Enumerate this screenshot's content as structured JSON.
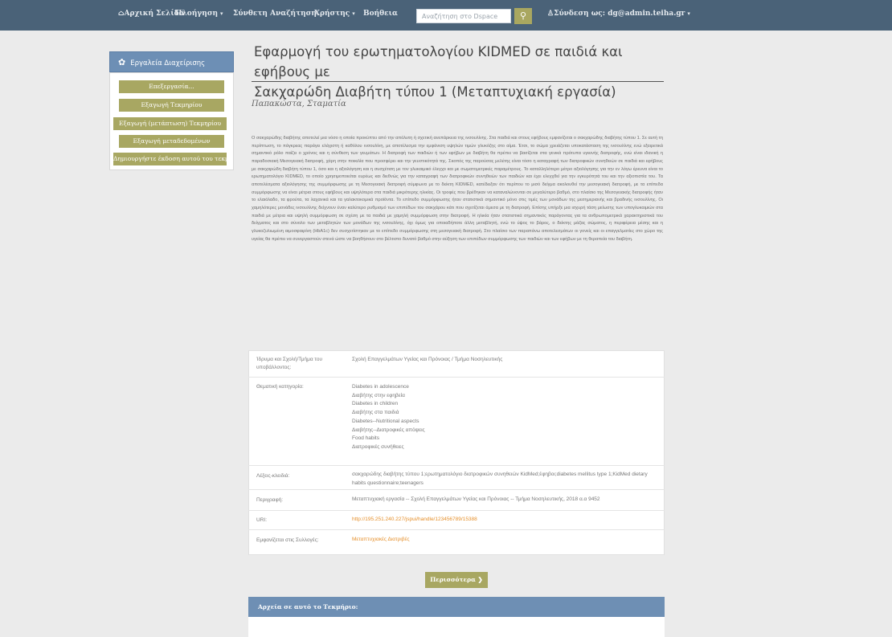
{
  "navbar": {
    "home": "Αρχική Σελίδα",
    "browse": "Πλοήγηση",
    "advanced_search": "Σύνθετη Αναζήτηση",
    "user": "Χρήστης",
    "help": "Βοήθεια",
    "search_placeholder": "Αναζήτηση στο Dspace",
    "login": "Σύνδεση ως: dg@admin.teiha.gr"
  },
  "sidebar": {
    "title": "Εργαλεία Διαχείρισης",
    "buttons": [
      "Επεξεργασία...",
      "Εξαγωγή Τεκμηρίου",
      "Εξαγωγή (μετάπτωση) Τεκμηρίου",
      "Εξαγωγή μεταδεδομένων",
      "Δημιουργήστε έκδοση αυτού του τεκμηρίου"
    ]
  },
  "item": {
    "title_line1": "Εφαρμογή του ερωτηματολογίου KIDMED σε παιδιά και εφήβους με",
    "title_line2": "Σακχαρώδη Διαβήτη τύπου 1 (Μεταπτυχιακή εργασία)",
    "author": "Παπακώστα, Σταματία",
    "abstract": "Ο σακχαρώδης διαβήτης αποτελεί μια νόσο η οποία προκύπτει από την απόλυτη ή σχετική ανεπάρκεια της ινσουλίνης. Στα παιδιά και στους εφήβους εμφανίζεται ο σακχαρώδης διαβήτης τύπου 1. Σε αυτή τη περίπτωση, το πάγκρεας παράγει ελάχιστη ή καθόλου ινσουλίνη, με αποτέλεσμα την εμφάνιση υψηλών τιμών γλυκόζης στο αίμα. Έτσι, το σώμα χρειάζεται υποκατάσταση της ινσουλίνης ενώ εξαιρετικά σημαντικό ρόλο παίζει ο χρόνος και η σύνθεση των γευμάτων. Η διατροφή των παιδιών ή των εφήβων με διαβήτη θα πρέπει να βασίζεται στα γενικά πρότυπα υγιεινής διατροφής, ενώ είναι ιδανική η παραδοσιακή Μεσογειακή διατροφή, χάρη στην ποικιλία που προσφέρει και την γευστικότητά της. Σκοπός της παρούσας μελέτης είναι τόσο η καταγραφή των διατροφικών συνηθειών σε παιδιά και εφήβους με σακχαρώδη διαβήτη τύπου 1, όσο και η αξιολόγηση και η συσχέτιση με τον γλυκαιμικό έλεγχο και με σωματομετρικές παραμέτρους. Το καταλληλότερο μέτρο αξιολόγησης για την εν λόγω έρευνα είναι το ερωτηματολόγιο KIDMED, το οποίο χρησιμοποιείται ευρέως και διεθνώς για την καταγραφή των διατροφικών συνηθειών των παιδιών και έχει ελεγχθεί για την εγκυρότητά του και την αξιοπιστία του. Τα αποτελέσματα αξιολόγησης της συμμόρφωσης με τη Μεσογειακή διατροφή σύμφωνα με το δείκτη KIDMED, κατέδειξαν ότι περίπου το μισό δείγμα ακολουθεί την μεσογειακή διατροφή, με τα επίπεδα συμμόρφωσης να είναι μέτρια στους εφήβους και υψηλότερα στα παιδιά μικρότερης ηλικίας. Οι τροφές που βρέθηκαν να καταναλώνονται σε μεγαλύτερο βαθμό, στο πλαίσιο της Μεσογειακής διατροφής ήταν το ελαιόλαδο, τα φρούτα, τα λαχανικά και τα γαλακτοκομικά προϊόντα. Το επίπεδο συμμόρφωσης ήταν στατιστικά σημαντικό μόνο στις τιμές των μονάδων της μεσημεριανής και βραδινής ινσουλίνης. Οι χαμηλότερες μονάδες ινσουλίνης δείχνουν έναν καλύτερο ρυθμισμό των επιπέδων του σακχάρου κάτι που σχετίζεται άμεσα με τη διατροφή. Επίσης υπήρξε μια ισχυρή τάση μείωσης των υπογλυκαιμιών στα παιδιά με μέτρια και υψηλή συμμόρφωση σε σχέση με τα παιδιά με χαμηλή συμμόρφωση στην διατροφή. Η ηλικία ήταν στατιστικά σημαντικός παράγοντας για τα ανθρωπομετρικά χαρακτηριστικά του δείγματος και στο σύνολο των μεταβλητών των μονάδων της ινσουλίνης, όχι όμως για οποιαδήποτε άλλη μεταβλητή, ενώ το ύψος το βάρος, ο δείκτης μάζας σώματος, η περιφέρεια μέσης και η γλυκοζυλιωμένη αιμοσφαιρίνη (HbA1c) δεν συσχετίστηκαν με το επίπεδο συμμόρφωσης στη μεσογειακή διατροφή. Στο πλαίσιο των παραπάνω αποτελεσμάτων οι γονείς και οι επαγγελματίες στο χώρο της υγείας θα πρέπει να συνεργαστούν στενά ώστε να βοηθήσουν στο βέλτιστο δυνατό βαθμό στην αύξηση των επιπέδων συμμόρφωσης των παιδιών και των εφήβων με τη θεραπεία του διαβήτη."
  },
  "metadata": {
    "institution_label": "Ίδρυμα και Σχολή/Τμήμα του υποβάλλοντος:",
    "institution_value": "Σχολή Επαγγελμάτων Υγείας και Πρόνοιας / Τμήμα Νοσηλευτικής",
    "subject_label": "Θεματική κατηγορία:",
    "subjects": [
      "Diabetes in adolescence",
      "Διαβήτης στην εφηβεία",
      "Diabetes in children",
      "Διαβήτης στα παιδιά",
      "Diabetes--Nutritional aspects",
      "Διαβήτης--Διατροφικές απόψεις",
      "Food habits",
      "Διατροφικές συνήθειες"
    ],
    "keywords_label": "Λέξεις-κλειδιά:",
    "keywords_value": "σακχαρώδης διαβήτης τύπου 1;ερωτηματολόγιο διατροφικών συνηθειών KidMed;έφηβοι;diabetes mellitus type 1;KidMed dietary habits questionnaire;teenagers",
    "description_label": "Περιγραφή:",
    "description_value": "Μεταπτυχιακή εργασία -- Σχολή Επαγγελμάτων Υγείας και Πρόνοιας -- Τμήμα Νοσηλευτικής, 2018 α.α 9452",
    "uri_label": "URI:",
    "uri_value": "http://195.251.240.227/jspui/handle/123456789/15388",
    "collections_label": "Εμφανίζεται στις Συλλογές:",
    "collections_value": "Μεταπτυχιακές Διατριβές"
  },
  "next_button": "Περισσότερα",
  "files_heading": "Αρχεία σε αυτό το Τεκμήριο:",
  "colors": {
    "navbar": "#4a6278",
    "accent_olive": "#a8a762",
    "panel_blue": "#6e8fb4",
    "link_orange": "#e58f2a"
  }
}
